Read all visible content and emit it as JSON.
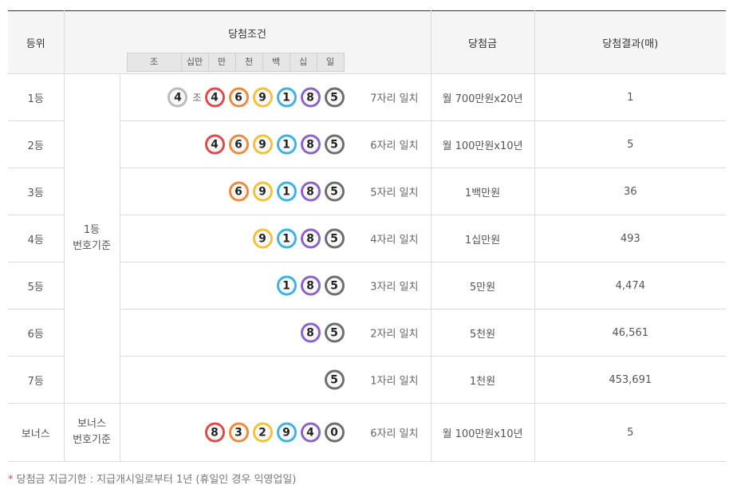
{
  "headers": {
    "rank": "등위",
    "condition": "당첨조건",
    "prize": "당첨금",
    "result": "당첨결과(매)",
    "digits": [
      "조",
      "십만",
      "만",
      "천",
      "백",
      "십",
      "일"
    ]
  },
  "basis": {
    "first": [
      "1등",
      "번호기준"
    ],
    "bonus": [
      "보너스",
      "번호기준"
    ]
  },
  "jo_label": "조",
  "rows": [
    {
      "rank": "1등",
      "jo": "4",
      "balls": [
        "4",
        "6",
        "9",
        "1",
        "8",
        "5"
      ],
      "colors": [
        "red",
        "orange",
        "yellow",
        "blue",
        "purple",
        "gray"
      ],
      "match": "7자리 일치",
      "prize": "월 700만원x20년",
      "count": "1"
    },
    {
      "rank": "2등",
      "balls": [
        "4",
        "6",
        "9",
        "1",
        "8",
        "5"
      ],
      "colors": [
        "red",
        "orange",
        "yellow",
        "blue",
        "purple",
        "gray"
      ],
      "match": "6자리 일치",
      "prize": "월 100만원x10년",
      "count": "5"
    },
    {
      "rank": "3등",
      "balls": [
        "6",
        "9",
        "1",
        "8",
        "5"
      ],
      "colors": [
        "orange",
        "yellow",
        "blue",
        "purple",
        "gray"
      ],
      "match": "5자리 일치",
      "prize": "1백만원",
      "count": "36"
    },
    {
      "rank": "4등",
      "balls": [
        "9",
        "1",
        "8",
        "5"
      ],
      "colors": [
        "yellow",
        "blue",
        "purple",
        "gray"
      ],
      "match": "4자리 일치",
      "prize": "1십만원",
      "count": "493"
    },
    {
      "rank": "5등",
      "balls": [
        "1",
        "8",
        "5"
      ],
      "colors": [
        "blue",
        "purple",
        "gray"
      ],
      "match": "3자리 일치",
      "prize": "5만원",
      "count": "4,474"
    },
    {
      "rank": "6등",
      "balls": [
        "8",
        "5"
      ],
      "colors": [
        "purple",
        "gray"
      ],
      "match": "2자리 일치",
      "prize": "5천원",
      "count": "46,561"
    },
    {
      "rank": "7등",
      "balls": [
        "5"
      ],
      "colors": [
        "gray"
      ],
      "match": "1자리 일치",
      "prize": "1천원",
      "count": "453,691"
    },
    {
      "rank": "보너스",
      "balls": [
        "8",
        "3",
        "2",
        "9",
        "4",
        "0"
      ],
      "colors": [
        "red",
        "orange",
        "yellow",
        "blue",
        "purple",
        "gray"
      ],
      "match": "6자리 일치",
      "prize": "월 100만원x10년",
      "count": "5"
    }
  ],
  "note": {
    "star": "*",
    "text": "당첨금 지급기한 : 지급개시일로부터 1년 (휴일인 경우 익영업일)"
  },
  "colors": {
    "red": "#e04a4a",
    "orange": "#ec8b3d",
    "yellow": "#f2c23a",
    "blue": "#3bb4e3",
    "purple": "#8a64c8",
    "gray": "#6e6e6e",
    "prize_text": "#c0533b"
  }
}
